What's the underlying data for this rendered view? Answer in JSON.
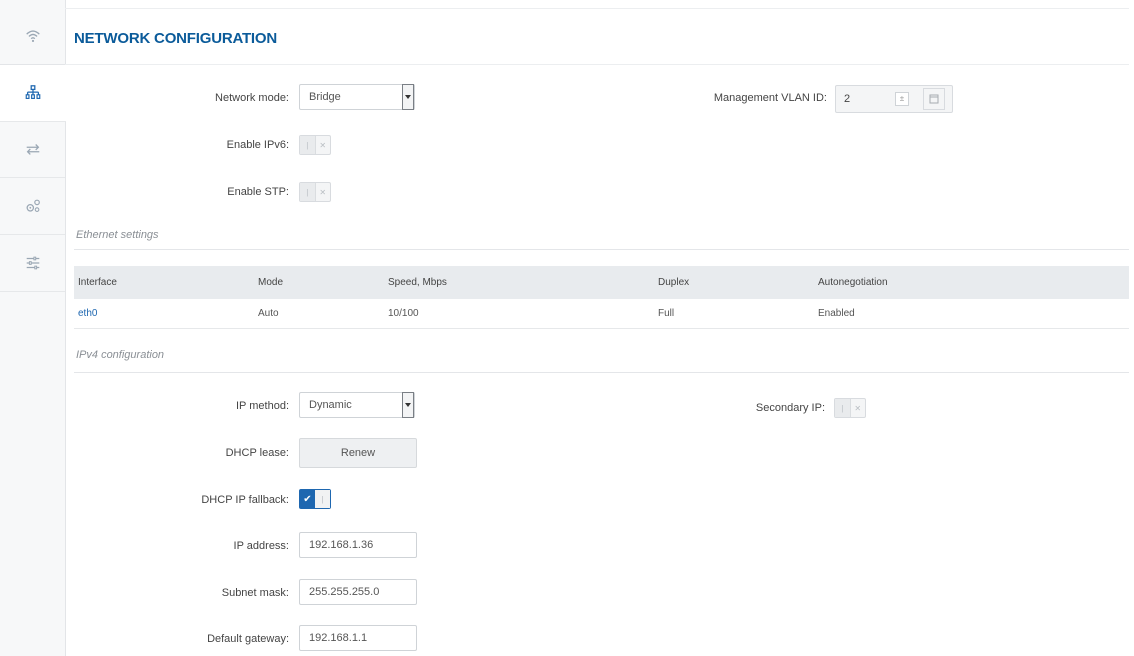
{
  "page": {
    "title": "NETWORK CONFIGURATION"
  },
  "sidebar": {
    "items": [
      {
        "icon": "wifi-icon"
      },
      {
        "icon": "network-icon",
        "active": true
      },
      {
        "icon": "routing-icon"
      },
      {
        "icon": "services-icon"
      },
      {
        "icon": "settings-sliders-icon"
      }
    ]
  },
  "network": {
    "mode_label": "Network mode:",
    "mode_value": "Bridge",
    "ipv6_label": "Enable IPv6:",
    "stp_label": "Enable STP:",
    "vlan_label": "Management VLAN ID:",
    "vlan_value": "2"
  },
  "ethernet": {
    "section_title": "Ethernet settings",
    "columns": [
      "Interface",
      "Mode",
      "Speed, Mbps",
      "Duplex",
      "Autonegotiation"
    ],
    "rows": [
      {
        "interface": "eth0",
        "mode": "Auto",
        "speed": "10/100",
        "duplex": "Full",
        "autoneg": "Enabled"
      }
    ]
  },
  "ipv4": {
    "section_title": "IPv4 configuration",
    "method_label": "IP method:",
    "method_value": "Dynamic",
    "secondary_label": "Secondary IP:",
    "lease_label": "DHCP lease:",
    "renew_label": "Renew",
    "fallback_label": "DHCP IP fallback:",
    "ip_label": "IP address:",
    "ip_value": "192.168.1.36",
    "mask_label": "Subnet mask:",
    "mask_value": "255.255.255.0",
    "gateway_label": "Default gateway:",
    "gateway_value": "192.168.1.1"
  },
  "colors": {
    "accent": "#0b5b9a",
    "toggle_on": "#1e67b0"
  }
}
